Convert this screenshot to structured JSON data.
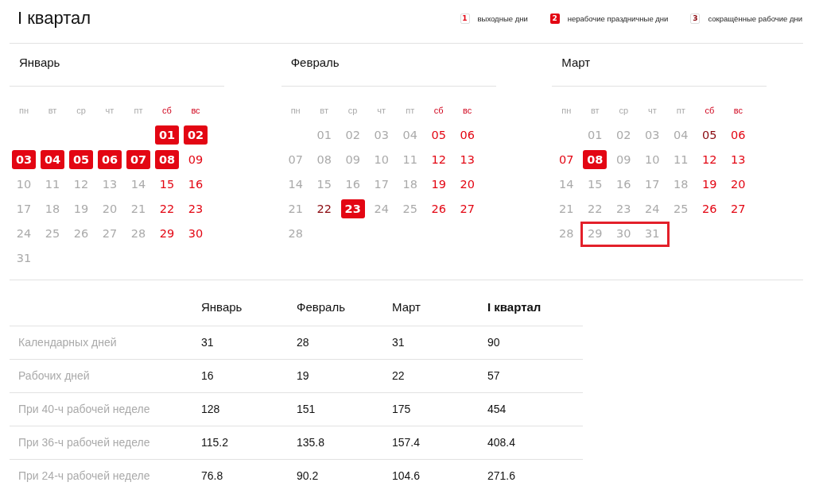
{
  "title": "I квартал",
  "legend": [
    {
      "number": "1",
      "label": "выходные дни",
      "kind": "weekend"
    },
    {
      "number": "2",
      "label": "нерабочие праздничные дни",
      "kind": "holiday"
    },
    {
      "number": "3",
      "label": "сокращённые рабочие дни",
      "kind": "short"
    }
  ],
  "months": [
    {
      "name": "Январь",
      "weekdays": [
        {
          "label": "пн",
          "weekend": false
        },
        {
          "label": "вт",
          "weekend": false
        },
        {
          "label": "ср",
          "weekend": false
        },
        {
          "label": "чт",
          "weekend": false
        },
        {
          "label": "пт",
          "weekend": false
        },
        {
          "label": "сб",
          "weekend": true
        },
        {
          "label": "вс",
          "weekend": true
        }
      ],
      "weeks": [
        [
          {
            "day": "01",
            "kind": "holiday"
          },
          {
            "day": "02",
            "kind": "holiday"
          }
        ],
        [
          {
            "day": "03",
            "kind": "holiday"
          },
          {
            "day": "04",
            "kind": "holiday"
          },
          {
            "day": "05",
            "kind": "holiday"
          },
          {
            "day": "06",
            "kind": "holiday"
          },
          {
            "day": "07",
            "kind": "holiday"
          },
          {
            "day": "08",
            "kind": "holiday"
          },
          {
            "day": "09",
            "kind": "weekend"
          }
        ],
        [
          {
            "day": "10",
            "kind": "work"
          },
          {
            "day": "11",
            "kind": "work"
          },
          {
            "day": "12",
            "kind": "work"
          },
          {
            "day": "13",
            "kind": "work"
          },
          {
            "day": "14",
            "kind": "work"
          },
          {
            "day": "15",
            "kind": "weekend"
          },
          {
            "day": "16",
            "kind": "weekend"
          }
        ],
        [
          {
            "day": "17",
            "kind": "work"
          },
          {
            "day": "18",
            "kind": "work"
          },
          {
            "day": "19",
            "kind": "work"
          },
          {
            "day": "20",
            "kind": "work"
          },
          {
            "day": "21",
            "kind": "work"
          },
          {
            "day": "22",
            "kind": "weekend"
          },
          {
            "day": "23",
            "kind": "weekend"
          }
        ],
        [
          {
            "day": "24",
            "kind": "work"
          },
          {
            "day": "25",
            "kind": "work"
          },
          {
            "day": "26",
            "kind": "work"
          },
          {
            "day": "27",
            "kind": "work"
          },
          {
            "day": "28",
            "kind": "work"
          },
          {
            "day": "29",
            "kind": "weekend"
          },
          {
            "day": "30",
            "kind": "weekend"
          }
        ],
        [
          {
            "day": "31",
            "kind": "work"
          }
        ]
      ]
    },
    {
      "name": "Февраль",
      "weekdays": [
        {
          "label": "пн",
          "weekend": false
        },
        {
          "label": "вт",
          "weekend": false
        },
        {
          "label": "ср",
          "weekend": false
        },
        {
          "label": "чт",
          "weekend": false
        },
        {
          "label": "пт",
          "weekend": false
        },
        {
          "label": "сб",
          "weekend": true
        },
        {
          "label": "вс",
          "weekend": true
        }
      ],
      "weeks": [
        [
          {
            "day": "01",
            "kind": "work"
          },
          {
            "day": "02",
            "kind": "work"
          },
          {
            "day": "03",
            "kind": "work"
          },
          {
            "day": "04",
            "kind": "work"
          },
          {
            "day": "05",
            "kind": "weekend"
          },
          {
            "day": "06",
            "kind": "weekend"
          }
        ],
        [
          {
            "day": "07",
            "kind": "work"
          },
          {
            "day": "08",
            "kind": "work"
          },
          {
            "day": "09",
            "kind": "work"
          },
          {
            "day": "10",
            "kind": "work"
          },
          {
            "day": "11",
            "kind": "work"
          },
          {
            "day": "12",
            "kind": "weekend"
          },
          {
            "day": "13",
            "kind": "weekend"
          }
        ],
        [
          {
            "day": "14",
            "kind": "work"
          },
          {
            "day": "15",
            "kind": "work"
          },
          {
            "day": "16",
            "kind": "work"
          },
          {
            "day": "17",
            "kind": "work"
          },
          {
            "day": "18",
            "kind": "work"
          },
          {
            "day": "19",
            "kind": "weekend"
          },
          {
            "day": "20",
            "kind": "weekend"
          }
        ],
        [
          {
            "day": "21",
            "kind": "work"
          },
          {
            "day": "22",
            "kind": "short"
          },
          {
            "day": "23",
            "kind": "holiday"
          },
          {
            "day": "24",
            "kind": "work"
          },
          {
            "day": "25",
            "kind": "work"
          },
          {
            "day": "26",
            "kind": "weekend"
          },
          {
            "day": "27",
            "kind": "weekend"
          }
        ],
        [
          {
            "day": "28",
            "kind": "work"
          }
        ]
      ]
    },
    {
      "name": "Март",
      "weekdays": [
        {
          "label": "пн",
          "weekend": false
        },
        {
          "label": "вт",
          "weekend": false
        },
        {
          "label": "ср",
          "weekend": false
        },
        {
          "label": "чт",
          "weekend": false
        },
        {
          "label": "пт",
          "weekend": false
        },
        {
          "label": "сб",
          "weekend": true
        },
        {
          "label": "вс",
          "weekend": true
        }
      ],
      "weeks": [
        [
          {
            "day": "01",
            "kind": "work"
          },
          {
            "day": "02",
            "kind": "work"
          },
          {
            "day": "03",
            "kind": "work"
          },
          {
            "day": "04",
            "kind": "work"
          },
          {
            "day": "05",
            "kind": "short"
          },
          {
            "day": "06",
            "kind": "weekend"
          }
        ],
        [
          {
            "day": "07",
            "kind": "weekend"
          },
          {
            "day": "08",
            "kind": "holiday"
          },
          {
            "day": "09",
            "kind": "work"
          },
          {
            "day": "10",
            "kind": "work"
          },
          {
            "day": "11",
            "kind": "work"
          },
          {
            "day": "12",
            "kind": "weekend"
          },
          {
            "day": "13",
            "kind": "weekend"
          }
        ],
        [
          {
            "day": "14",
            "kind": "work"
          },
          {
            "day": "15",
            "kind": "work"
          },
          {
            "day": "16",
            "kind": "work"
          },
          {
            "day": "17",
            "kind": "work"
          },
          {
            "day": "18",
            "kind": "work"
          },
          {
            "day": "19",
            "kind": "weekend"
          },
          {
            "day": "20",
            "kind": "weekend"
          }
        ],
        [
          {
            "day": "21",
            "kind": "work"
          },
          {
            "day": "22",
            "kind": "work"
          },
          {
            "day": "23",
            "kind": "work"
          },
          {
            "day": "24",
            "kind": "work"
          },
          {
            "day": "25",
            "kind": "work"
          },
          {
            "day": "26",
            "kind": "weekend"
          },
          {
            "day": "27",
            "kind": "weekend"
          }
        ],
        [
          {
            "day": "28",
            "kind": "work"
          },
          {
            "day": "29",
            "kind": "work",
            "framed": true
          },
          {
            "day": "30",
            "kind": "work",
            "framed": true
          },
          {
            "day": "31",
            "kind": "work",
            "framed": true
          }
        ]
      ]
    }
  ],
  "table": {
    "columns": [
      "Январь",
      "Февраль",
      "Март",
      "I квартал"
    ],
    "rows": [
      {
        "label": "Календарных дней",
        "values": [
          "31",
          "28",
          "31",
          "90"
        ]
      },
      {
        "label": "Рабочих дней",
        "values": [
          "16",
          "19",
          "22",
          "57"
        ]
      },
      {
        "label": "При 40-ч рабочей неделе",
        "values": [
          "128",
          "151",
          "175",
          "454"
        ]
      },
      {
        "label": "При 36-ч рабочей неделе",
        "values": [
          "115.2",
          "135.8",
          "157.4",
          "408.4"
        ]
      },
      {
        "label": "При 24-ч рабочей неделе",
        "values": [
          "76.8",
          "90.2",
          "104.6",
          "271.6"
        ]
      }
    ]
  }
}
